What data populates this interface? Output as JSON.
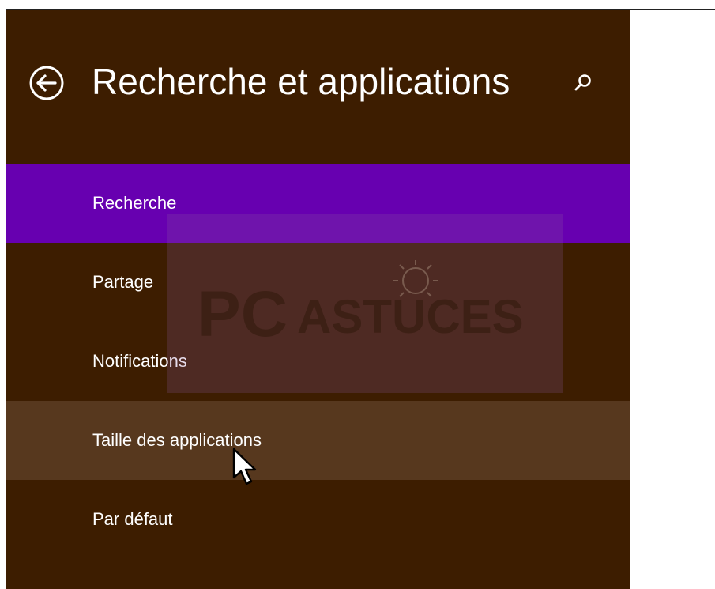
{
  "header": {
    "title": "Recherche et applications",
    "back_icon": "back-arrow-circle-icon",
    "search_icon": "search-icon"
  },
  "nav": {
    "items": [
      {
        "label": "Recherche",
        "state": "selected"
      },
      {
        "label": "Partage",
        "state": "normal"
      },
      {
        "label": "Notifications",
        "state": "normal"
      },
      {
        "label": "Taille des applications",
        "state": "hovered"
      },
      {
        "label": "Par défaut",
        "state": "normal"
      }
    ]
  },
  "watermark": {
    "text_pc": "PC",
    "text_astuces": "ASTUCES"
  },
  "colors": {
    "panel_background": "#3d1d00",
    "selected_item": "#6700b0",
    "hovered_item": "#57381e",
    "text": "#ffffff"
  }
}
